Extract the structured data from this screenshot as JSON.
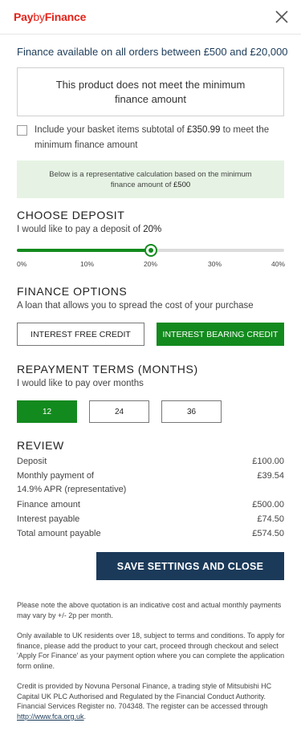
{
  "header": {
    "logo_pay": "Pay",
    "logo_by": "by",
    "logo_finance": "Finance"
  },
  "availability": {
    "prefix": "Finance available on all orders between ",
    "min": "£500",
    "and": " and ",
    "max": "£20,000"
  },
  "warning": "This product does not meet the minimum finance amount",
  "basket_option": {
    "text_prefix": "Include your basket items subtotal of ",
    "amount": "£350.99",
    "text_suffix": " to meet the minimum finance amount",
    "checked": false
  },
  "info_box": {
    "text_prefix": "Below is a representative calculation based on the minimum finance amount of ",
    "amount": "£500"
  },
  "deposit": {
    "title": "CHOOSE DEPOSIT",
    "sub_prefix": "I would like to pay a deposit of ",
    "value": "20%",
    "slider_fraction": 0.5,
    "ticks": [
      "0%",
      "10%",
      "20%",
      "30%",
      "40%"
    ]
  },
  "finance_options": {
    "title": "FINANCE OPTIONS",
    "sub": "A loan that allows you to spread the cost of your purchase",
    "interest_free": "INTEREST FREE CREDIT",
    "interest_bearing": "INTEREST BEARING CREDIT",
    "selected": "interest_bearing"
  },
  "repayment": {
    "title": "REPAYMENT TERMS (MONTHS)",
    "sub": "I would like to pay over months",
    "terms": [
      "12",
      "24",
      "36"
    ],
    "selected": "12"
  },
  "review": {
    "title": "REVIEW",
    "deposit_label": "Deposit",
    "deposit_value": "£100.00",
    "monthly_label": "Monthly payment of",
    "monthly_value": "£39.54",
    "apr_label": "14.9% APR (representative)",
    "finance_label": "Finance amount",
    "finance_value": "£500.00",
    "interest_label": "Interest payable",
    "interest_value": "£74.50",
    "total_label": "Total amount payable",
    "total_value": "£574.50"
  },
  "save_button": "SAVE SETTINGS AND CLOSE",
  "notes": {
    "quotation": "Please note the above quotation is an indicative cost and actual monthly payments may vary by +/- 2p per month.",
    "availability": "Only available to UK residents over 18, subject to terms and conditions. To apply for finance, please add the product to your cart, proceed through checkout and select 'Apply For Finance' as your payment option where you can complete the application form online.",
    "credit_prefix": "Credit is provided by Novuna Personal Finance, a trading style of Mitsubishi HC Capital UK PLC Authorised and Regulated by the Financial Conduct Authority. Financial Services Register no. 704348. The register can be accessed through ",
    "link": "http://www.fca.org.uk",
    "credit_suffix": "."
  },
  "colors": {
    "brand_red": "#e2231a",
    "accent_green": "#138a1e",
    "navy": "#1b3a5a",
    "info_bg": "#e6f3e4"
  }
}
